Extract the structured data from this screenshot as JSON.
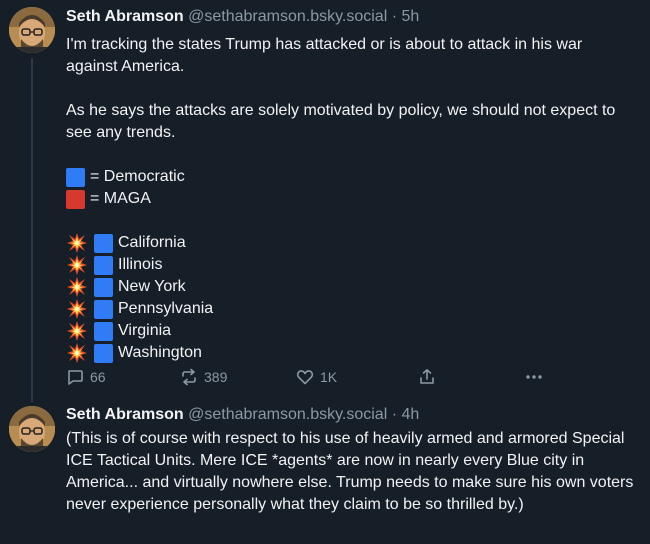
{
  "posts": [
    {
      "author": "Seth Abramson",
      "handle": "@sethabramson.bsky.social",
      "separator": "·",
      "time": "5h",
      "paragraphs": [
        "I'm tracking the states Trump has attacked or is about to attack in his war against America.",
        "As he says the attacks are solely motivated by policy, we should not expect to see any trends."
      ],
      "legend": [
        {
          "color": "#2f7cf6",
          "label": "= Democratic"
        },
        {
          "color": "#d8392e",
          "label": "= MAGA"
        }
      ],
      "states": [
        "California",
        "Illinois",
        "New York",
        "Pennsylvania",
        "Virginia",
        "Washington"
      ],
      "actions": {
        "replies": "66",
        "reposts": "389",
        "likes": "1K"
      }
    },
    {
      "author": "Seth Abramson",
      "handle": "@sethabramson.bsky.social",
      "separator": "·",
      "time": "4h",
      "text": "(This is of course with respect to his use of heavily armed and armored Special ICE Tactical Units. Mere ICE *agents* are now in nearly every Blue city in America... and virtually nowhere else. Trump needs to make sure his own voters never experience personally what they claim to be so thrilled by.)"
    }
  ],
  "icons": {
    "reply": "speech-bubble-icon",
    "repost": "repost-arrows-icon",
    "like": "heart-icon",
    "share": "share-upload-icon",
    "more": "more-dots-icon",
    "state_marker": "collision-emoji-icon",
    "party_marker": "colored-square-icon"
  },
  "colors": {
    "background": "#161e27",
    "text": "#f1f3f5",
    "muted": "#8b98a5",
    "democratic": "#2f7cf6",
    "maga": "#d8392e"
  }
}
